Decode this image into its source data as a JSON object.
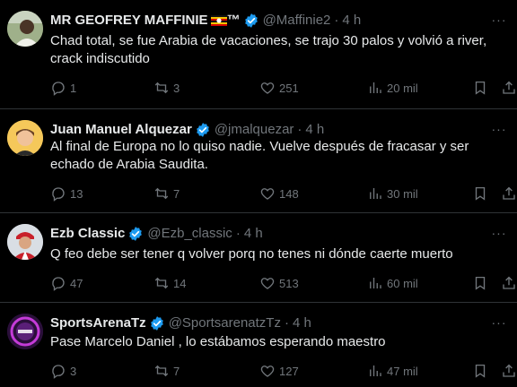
{
  "tweets": [
    {
      "name": "MR GEOFREY MAFFINIE",
      "name_suffix": "™",
      "handle": "@Maffinie2",
      "time": "4 h",
      "text": "Chad total, se fue Arabia de vacaciones, se trajo 30 palos y volvió a river, crack indiscutido",
      "replies": "1",
      "retweets": "3",
      "likes": "251",
      "views": "20 mil"
    },
    {
      "name": "Juan Manuel Alquezar",
      "handle": "@jmalquezar",
      "time": "4 h",
      "text": "Al final de Europa no lo quiso nadie. Vuelve después de fracasar y ser echado de Arabia Saudita.",
      "replies": "13",
      "retweets": "7",
      "likes": "148",
      "views": "30 mil"
    },
    {
      "name": "Ezb Classic",
      "handle": "@Ezb_classic",
      "time": "4 h",
      "text": "Q feo debe ser tener q volver porq no tenes ni dónde caerte muerto",
      "replies": "47",
      "retweets": "14",
      "likes": "513",
      "views": "60 mil"
    },
    {
      "name": "SportsArenaTz",
      "handle": "@SportsarenatzTz",
      "time": "4 h",
      "text": "Pase Marcelo Daniel , lo estábamos esperando maestro",
      "replies": "3",
      "retweets": "7",
      "likes": "127",
      "views": "47 mil"
    }
  ],
  "separator": "·",
  "more_label": "···",
  "colors": {
    "background": "#000000",
    "text": "#e7e9ea",
    "muted": "#71767b",
    "verified": "#1d9bf0",
    "divider": "#2f3336"
  }
}
